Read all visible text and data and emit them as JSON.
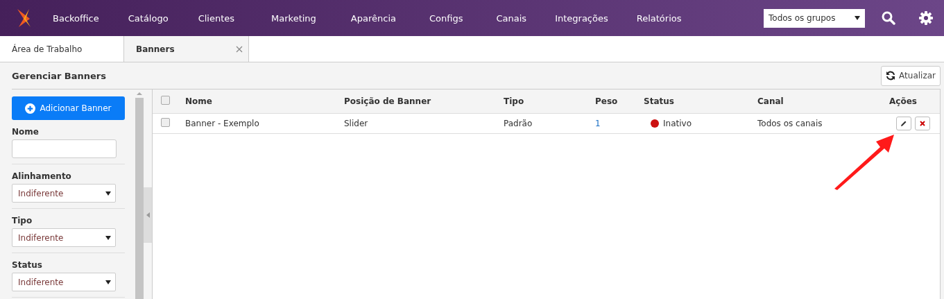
{
  "nav": {
    "items": [
      "Backoffice",
      "Catálogo",
      "Clientes",
      "Marketing",
      "Aparência",
      "Configs",
      "Canais",
      "Integrações",
      "Relatórios"
    ],
    "group_select": "Todos os grupos"
  },
  "tabs": [
    {
      "label": "Área de Trabalho",
      "selected": false,
      "closable": false
    },
    {
      "label": "Banners",
      "selected": true,
      "closable": true
    }
  ],
  "page": {
    "title": "Gerenciar Banners",
    "refresh_button": "Atualizar"
  },
  "sidebar": {
    "add_button": "Adicionar Banner",
    "filters": [
      {
        "kind": "text",
        "label": "Nome"
      },
      {
        "kind": "select",
        "label": "Alinhamento",
        "value": "Indiferente"
      },
      {
        "kind": "select",
        "label": "Tipo",
        "value": "Indiferente"
      },
      {
        "kind": "select",
        "label": "Status",
        "value": "Indiferente"
      }
    ]
  },
  "table": {
    "all_checked": false,
    "columns": [
      "Nome",
      "Posição de Banner",
      "Tipo",
      "Peso",
      "Status",
      "Canal",
      "Ações"
    ],
    "rows": [
      {
        "checked": false,
        "name": "Banner - Exemplo",
        "position": "Slider",
        "type": "Padrão",
        "weight": "1",
        "status": {
          "label": "Inativo",
          "color": "#cc1111"
        },
        "channel": "Todos os canais"
      }
    ]
  }
}
